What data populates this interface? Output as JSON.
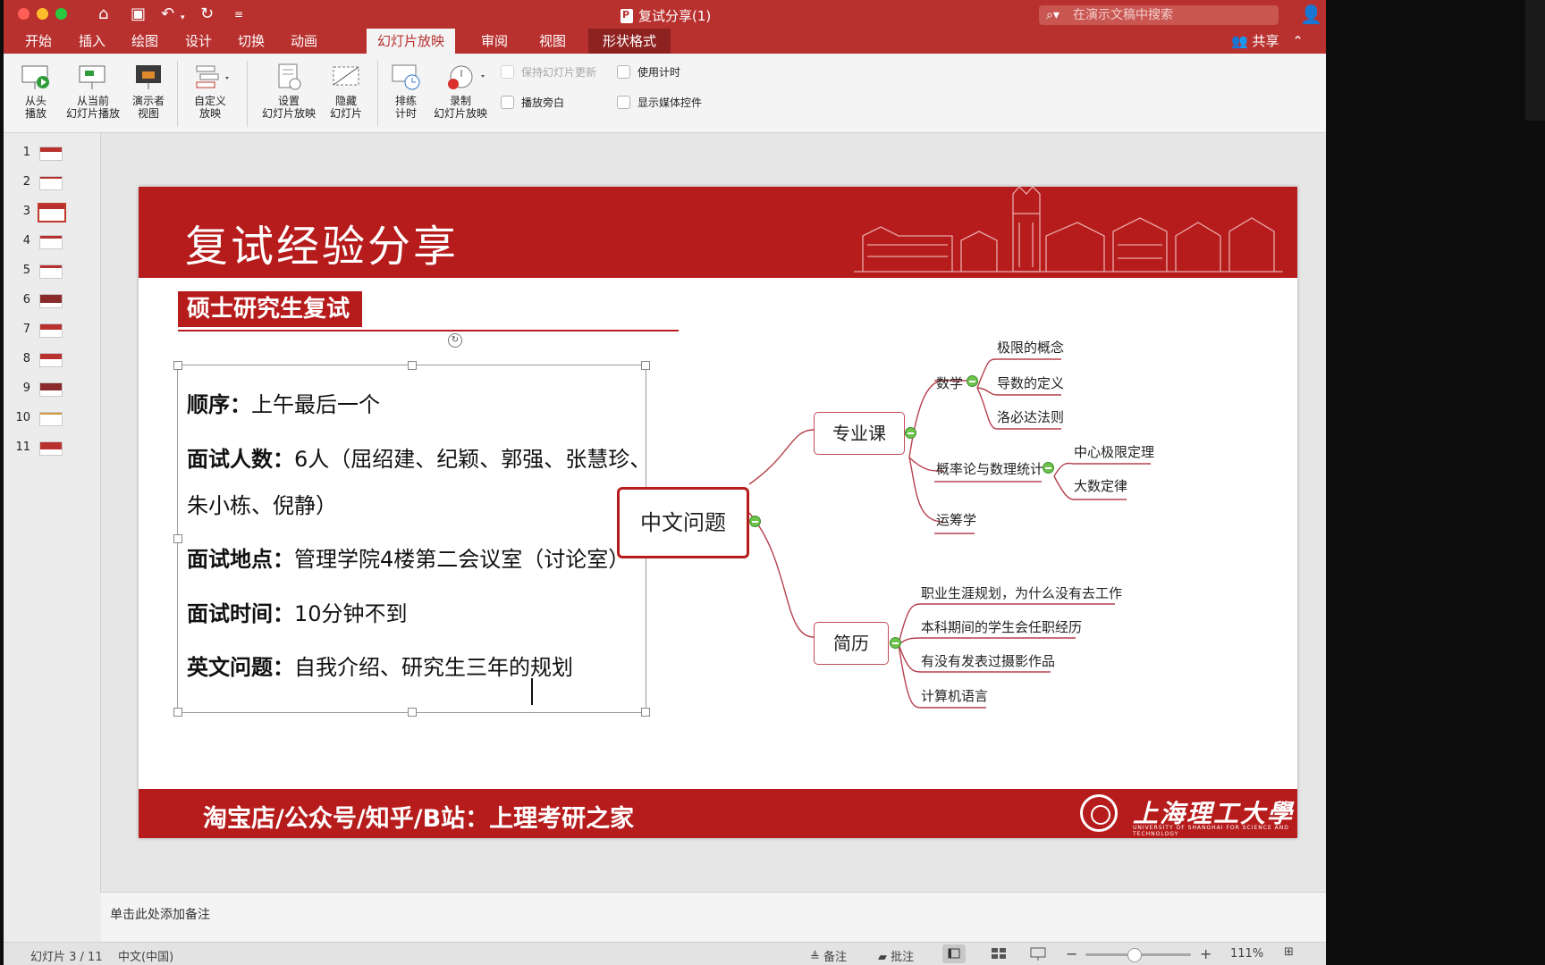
{
  "window": {
    "title": "复试分享(1)",
    "search_placeholder": "在演示文稿中搜索"
  },
  "tabs": [
    {
      "label": "开始"
    },
    {
      "label": "插入"
    },
    {
      "label": "绘图"
    },
    {
      "label": "设计"
    },
    {
      "label": "切换"
    },
    {
      "label": "动画"
    },
    {
      "label": "幻灯片放映"
    },
    {
      "label": "审阅"
    },
    {
      "label": "视图"
    },
    {
      "label": "形状格式"
    }
  ],
  "active_tab": "幻灯片放映",
  "share_label": "共享",
  "ribbon": {
    "from_start": [
      "从头",
      "播放"
    ],
    "from_current": [
      "从当前",
      "幻灯片播放"
    ],
    "presenter": [
      "演示者",
      "视图"
    ],
    "custom": [
      "自定义",
      "放映"
    ],
    "setup": [
      "设置",
      "幻灯片放映"
    ],
    "hide": [
      "隐藏",
      "幻灯片"
    ],
    "rehearse": [
      "排练",
      "计时"
    ],
    "record": [
      "录制",
      "幻灯片放映"
    ],
    "keep_updated": "保持幻灯片更新",
    "use_timing": "使用计时",
    "narration": "播放旁白",
    "media_controls": "显示媒体控件"
  },
  "thumbnails": [
    "1",
    "2",
    "3",
    "4",
    "5",
    "6",
    "7",
    "8",
    "9",
    "10",
    "11"
  ],
  "selected_slide": 3,
  "slide": {
    "title": "复试经验分享",
    "subtitle": "硕士研究生复试",
    "lines": [
      {
        "label": "顺序：",
        "text": "上午最后一个"
      },
      {
        "label": "面试人数：",
        "text": "6人（屈绍建、纪颖、郭强、张慧珍、"
      },
      {
        "label": "",
        "text": "朱小栋、倪静）"
      },
      {
        "label": "面试地点：",
        "text": "管理学院4楼第二会议室（讨论室）"
      },
      {
        "label": "面试时间：",
        "text": "10分钟不到"
      },
      {
        "label": "英文问题：",
        "text": "自我介绍、研究生三年的规划"
      }
    ],
    "footer_text": "淘宝店/公众号/知乎/B站：上理考研之家",
    "logo_text": "上海理工大學",
    "logo_sub": "UNIVERSITY OF SHANGHAI FOR SCIENCE AND TECHNOLOGY"
  },
  "mindmap": {
    "root": "中文问题",
    "major": "专业课",
    "math": "数学",
    "math_items": [
      "极限的概念",
      "导数的定义",
      "洛必达法则"
    ],
    "prob": "概率论与数理统计",
    "prob_items": [
      "中心极限定理",
      "大数定律"
    ],
    "ops": "运筹学",
    "resume": "简历",
    "resume_items": [
      "职业生涯规划，为什么没有去工作",
      "本科期间的学生会任职经历",
      "有没有发表过摄影作品",
      "计算机语言"
    ]
  },
  "notes_placeholder": "单击此处添加备注",
  "status": {
    "slide_info": "幻灯片 3 / 11",
    "language": "中文(中国)",
    "notes": "备注",
    "comments": "批注",
    "zoom": "111%",
    "zoom_fraction": 0.47
  },
  "colors": {
    "ribbon_red": "#b8312f",
    "slide_red": "#b71c1c",
    "mindmap_line": "#b5404d",
    "collapse_green": "#6cc24a"
  }
}
